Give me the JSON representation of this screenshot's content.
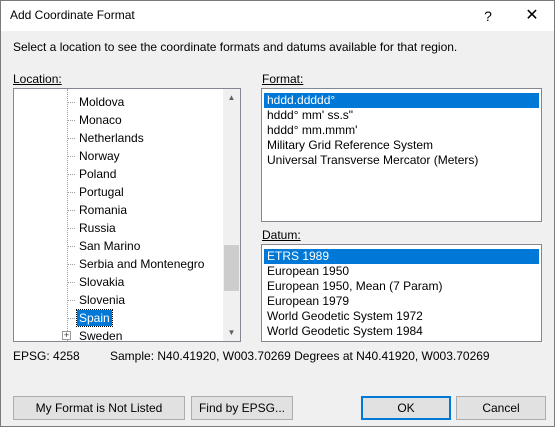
{
  "window": {
    "title": "Add Coordinate Format",
    "help_glyph": "?",
    "close_glyph": "✕"
  },
  "instructions": "Select a location to see the coordinate formats and datums available for that region.",
  "location": {
    "label": "Location:",
    "items": [
      {
        "label": "Moldova"
      },
      {
        "label": "Monaco"
      },
      {
        "label": "Netherlands"
      },
      {
        "label": "Norway"
      },
      {
        "label": "Poland"
      },
      {
        "label": "Portugal"
      },
      {
        "label": "Romania"
      },
      {
        "label": "Russia"
      },
      {
        "label": "San Marino"
      },
      {
        "label": "Serbia and Montenegro"
      },
      {
        "label": "Slovakia"
      },
      {
        "label": "Slovenia"
      },
      {
        "label": "Spain",
        "selected": true
      },
      {
        "label": "Sweden",
        "expander": "+"
      }
    ]
  },
  "format": {
    "label": "Format:",
    "items": [
      {
        "label": "hddd.ddddd°",
        "selected": true
      },
      {
        "label": "hddd° mm' ss.s\""
      },
      {
        "label": "hddd° mm.mmm'"
      },
      {
        "label": "Military Grid Reference System"
      },
      {
        "label": "Universal Transverse Mercator (Meters)"
      }
    ]
  },
  "datum": {
    "label": "Datum:",
    "items": [
      {
        "label": "ETRS 1989",
        "selected": true
      },
      {
        "label": "European 1950"
      },
      {
        "label": "European 1950, Mean (7 Param)"
      },
      {
        "label": "European 1979"
      },
      {
        "label": "World Geodetic System 1972"
      },
      {
        "label": "World Geodetic System 1984"
      }
    ]
  },
  "status": {
    "epsg": "EPSG: 4258",
    "sample": "Sample: N40.41920, W003.70269 Degrees at N40.41920, W003.70269"
  },
  "buttons": {
    "not_listed": "My Format is Not Listed",
    "find_epsg": "Find by EPSG...",
    "ok": "OK",
    "cancel": "Cancel"
  }
}
